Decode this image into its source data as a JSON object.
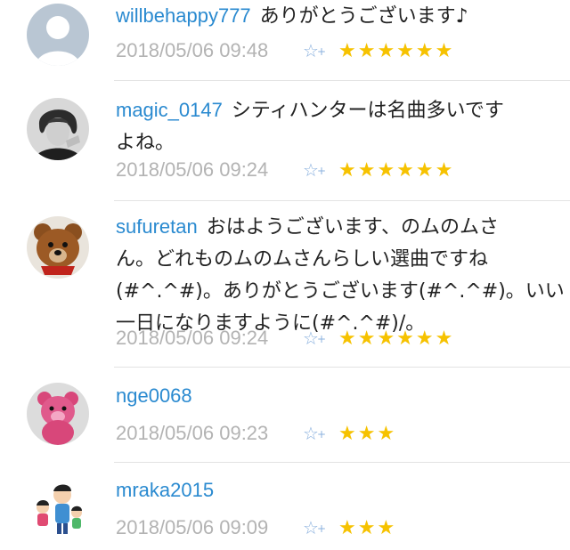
{
  "comments": [
    {
      "username": "willbehappy777",
      "text": "ありがとうございます♪",
      "text_line2": "",
      "text_line3": "",
      "text_line4": "",
      "timestamp": "2018/05/06 09:48",
      "stars": "★★★★★★",
      "star_count": 6,
      "avatar": "default-user-silhouette"
    },
    {
      "username": "magic_0147",
      "text": "シティハンターは名曲多いです",
      "text_line2": "よね。",
      "text_line3": "",
      "text_line4": "",
      "timestamp": "2018/05/06 09:24",
      "stars": "★★★★★★",
      "star_count": 6,
      "avatar": "man-portrait"
    },
    {
      "username": "sufuretan",
      "text": "おはようございます、のムのムさ",
      "text_line2": "ん。どれものムのムさんらしい選曲ですね",
      "text_line3": "(#^.^#)。ありがとうございます(#^.^#)。いい",
      "text_line4": "一日になりますように(#^.^#)/。",
      "timestamp": "2018/05/06 09:24",
      "stars": "★★★★★★",
      "star_count": 6,
      "avatar": "teddy-bear"
    },
    {
      "username": "nge0068",
      "text": "",
      "text_line2": "",
      "text_line3": "",
      "text_line4": "",
      "timestamp": "2018/05/06 09:23",
      "stars": "★★★",
      "star_count": 3,
      "avatar": "pink-bear"
    },
    {
      "username": "mraka2015",
      "text": "",
      "text_line2": "",
      "text_line3": "",
      "text_line4": "",
      "timestamp": "2018/05/06 09:09",
      "stars": "★★★",
      "star_count": 3,
      "avatar": "cartoon-family"
    }
  ],
  "icons": {
    "add_star": "☆",
    "add_star_plus": "+"
  },
  "colors": {
    "username": "#2a8ad0",
    "timestamp": "#b3b3b3",
    "star": "#f6c200",
    "add_star": "#8ab0de",
    "divider": "#e3e3e3"
  }
}
